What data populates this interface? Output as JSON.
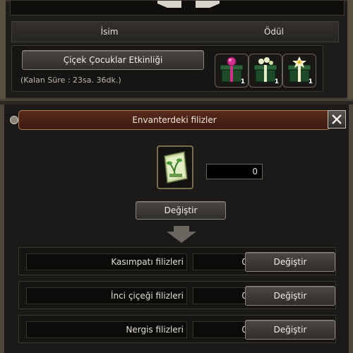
{
  "event_panel": {
    "header": {
      "name_label": "İsim",
      "reward_label": "Ödül"
    },
    "event_button_label": "Çiçek Çocuklar Etkinliği",
    "remaining_time": "(Kalan Süre : 23sa. 36dk.)",
    "rewards": [
      {
        "icon": "pink-flower-gift-icon",
        "qty": "1",
        "color": "#d0308a"
      },
      {
        "icon": "white-flower-gift-icon",
        "qty": "1",
        "color": "#e6eec8"
      },
      {
        "icon": "daffodil-gift-icon",
        "qty": "1",
        "color": "#f4f0d0"
      }
    ]
  },
  "inventory": {
    "title": "Envanterdeki filizler",
    "main_count": "0",
    "main_change_label": "Değiştir",
    "rows": [
      {
        "name": "Kasımpatı filizleri",
        "count": "0",
        "button": "Değiştir"
      },
      {
        "name": "İnci çiçeği filizleri",
        "count": "0",
        "button": "Değiştir"
      },
      {
        "name": "Nergis filizleri",
        "count": "0",
        "button": "Değiştir"
      }
    ]
  },
  "colors": {
    "title_bar": "#5a2a1c",
    "frame": "#4e463a",
    "gift_box": "#1f4a2a"
  }
}
